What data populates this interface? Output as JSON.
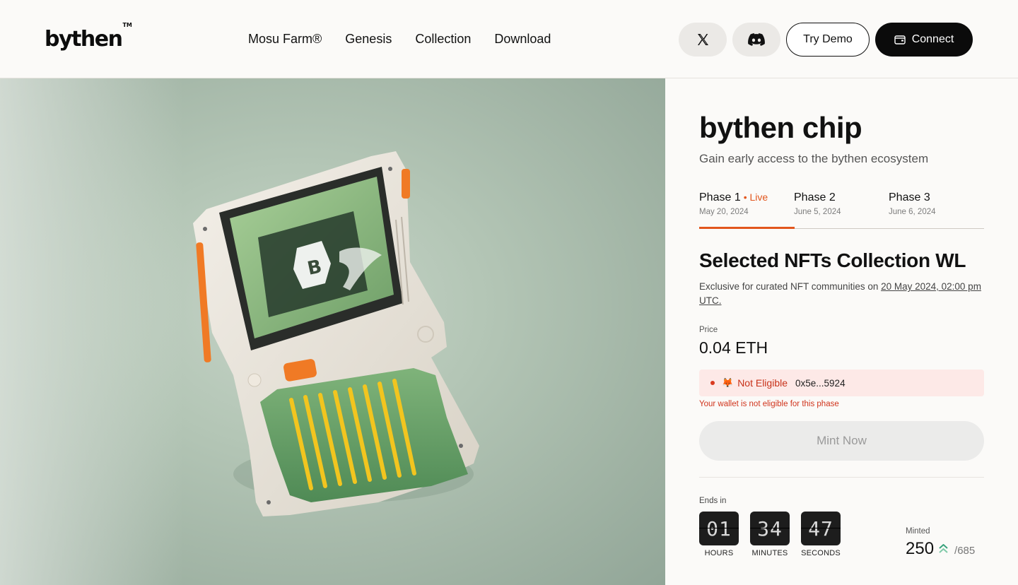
{
  "brand": {
    "logo": "bythen",
    "trademark": "TM"
  },
  "nav": {
    "items": [
      "Mosu Farm®",
      "Genesis",
      "Collection",
      "Download"
    ]
  },
  "header": {
    "try_demo": "Try Demo",
    "connect": "Connect"
  },
  "product": {
    "title": "bythen chip",
    "subtitle": "Gain early access to the bythen ecosystem"
  },
  "phases": [
    {
      "name": "Phase 1",
      "status": "• Live",
      "date": "May 20, 2024"
    },
    {
      "name": "Phase 2",
      "date": "June 5, 2024"
    },
    {
      "name": "Phase 3",
      "date": "June 6, 2024"
    }
  ],
  "wl": {
    "title": "Selected NFTs Collection WL",
    "desc_prefix": "Exclusive for curated NFT communities on ",
    "desc_date": "20 May 2024, 02:00 pm UTC."
  },
  "price": {
    "label": "Price",
    "value": "0.04 ETH"
  },
  "eligibility": {
    "status": "Not Eligible",
    "address": "0x5e...5924",
    "message": "Your wallet is not eligible for this phase"
  },
  "mint": {
    "label": "Mint Now"
  },
  "countdown": {
    "label": "Ends in",
    "hours": "01",
    "minutes": "34",
    "seconds": "47",
    "hours_label": "HOURS",
    "minutes_label": "MINUTES",
    "seconds_label": "SECONDS"
  },
  "minted": {
    "label": "Minted",
    "count": "250",
    "total": "/685"
  },
  "colors": {
    "accent": "#e2561d",
    "hero_bg": "#b4c6b6",
    "connect_bg": "#0b0b0b",
    "error": "#d0341c",
    "minted_icon": "#3aa37d"
  },
  "icons": [
    "x-icon",
    "discord-icon",
    "wallet-icon",
    "metamask-fox-icon",
    "double-chevron-up-icon"
  ]
}
